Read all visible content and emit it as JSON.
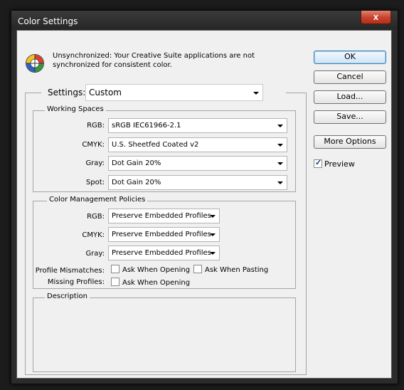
{
  "window": {
    "title": "Color Settings",
    "close_label": "x"
  },
  "notice": {
    "text_line1": "Unsynchronized: Your Creative Suite applications are not",
    "text_line2": "synchronized for consistent color."
  },
  "settings": {
    "label": "Settings:",
    "value": "Custom"
  },
  "working_spaces": {
    "title": "Working Spaces",
    "rgb": {
      "label": "RGB:",
      "value": "sRGB IEC61966-2.1"
    },
    "cmyk": {
      "label": "CMYK:",
      "value": "U.S. Sheetfed Coated v2"
    },
    "gray": {
      "label": "Gray:",
      "value": "Dot Gain 20%"
    },
    "spot": {
      "label": "Spot:",
      "value": "Dot Gain 20%"
    }
  },
  "policies": {
    "title": "Color Management Policies",
    "rgb": {
      "label": "RGB:",
      "value": "Preserve Embedded Profiles"
    },
    "cmyk": {
      "label": "CMYK:",
      "value": "Preserve Embedded Profiles"
    },
    "gray": {
      "label": "Gray:",
      "value": "Preserve Embedded Profiles"
    },
    "profile_mismatches_label": "Profile Mismatches:",
    "ask_when_opening": "Ask When Opening",
    "ask_when_pasting": "Ask When Pasting",
    "missing_profiles_label": "Missing Profiles:",
    "missing_ask_when_opening": "Ask When Opening"
  },
  "description": {
    "title": "Description"
  },
  "buttons": {
    "ok": "OK",
    "cancel": "Cancel",
    "load": "Load...",
    "save": "Save...",
    "more_options": "More Options"
  },
  "preview": {
    "label": "Preview",
    "checked": true
  }
}
